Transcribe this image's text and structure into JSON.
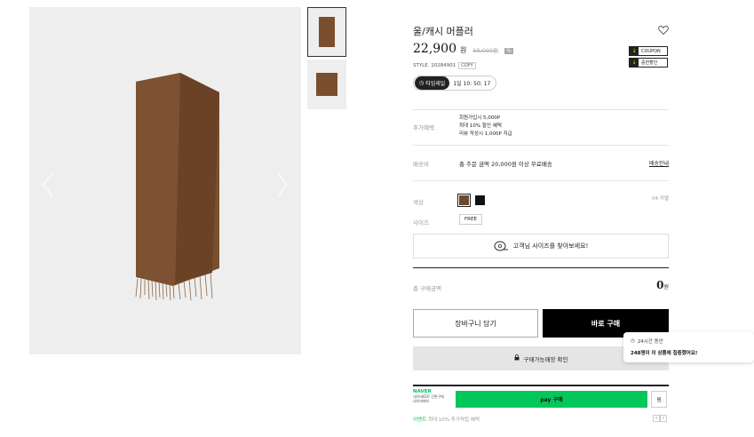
{
  "product": {
    "title": "울/캐시 머플러",
    "price": "22,900",
    "currency": "원",
    "original_price": "59,000원",
    "discount_badge": "%",
    "style_text": "STYLE. 10284901",
    "copy_label": "COPY",
    "timer_badge": "타임세일",
    "timer_value": "1일 10: 50: 17",
    "coupons": [
      "COUPON",
      "중한할인"
    ]
  },
  "benefits": {
    "label": "추가혜택",
    "lines": [
      "회원가입시 5,000P",
      "최대 10% 할인 혜택",
      "리뷰 작성시 1,000P 지급"
    ]
  },
  "shipping": {
    "label": "배송비",
    "text": "총 주문 금액 20,000원 이상 무료배송",
    "link": "배송안내"
  },
  "color": {
    "label": "색상",
    "count": "04 카멜",
    "swatch_colors": [
      "#6b4a30",
      "#111111"
    ]
  },
  "size": {
    "label": "사이즈",
    "option": "FREE",
    "finder_text": "고객님 사이즈를 찾아보세요!"
  },
  "total": {
    "label": "총 구매금액",
    "value": "0",
    "unit": "원"
  },
  "buttons": {
    "cart": "장바구니 담기",
    "buy": "바로 구매",
    "store_check": "구매가능매장 확인"
  },
  "npay": {
    "brand": "NAVER",
    "sub1": "네이버ID로 간편구매",
    "sub2": "네이버페이",
    "button": "pay 구매",
    "wish": "찜"
  },
  "event": {
    "tag": "이벤트",
    "text": "최대 10% 추가적립 혜택"
  },
  "tooltip": {
    "line1": "24시간 동안",
    "line2": "248명이 이 상품에 집중했어요!"
  },
  "colors": {
    "accent": "#000000",
    "naver_green": "#03c75a",
    "product_brown": "#7a4f2e"
  }
}
